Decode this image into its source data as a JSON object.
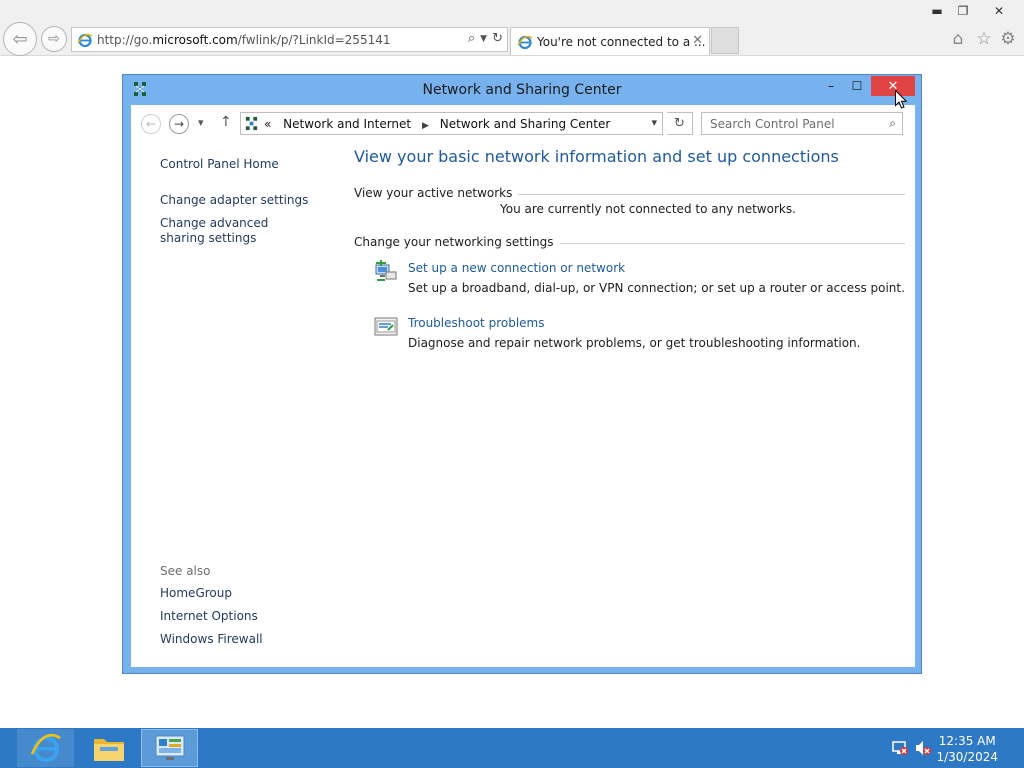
{
  "browser": {
    "url_prefix": "http://go.",
    "url_domain": "microsoft.com",
    "url_path": "/fwlink/p/?LinkId=255141",
    "tab_title": "You're not connected to a ...",
    "tab_close": "✕",
    "window_controls": {
      "minimize": "▬",
      "restore": "❐",
      "close": "✕"
    },
    "back_glyph": "⇦",
    "forward_glyph": "⇨",
    "icons": {
      "home": "⌂",
      "favorites": "☆",
      "tools": "⚙"
    }
  },
  "window": {
    "title": "Network and Sharing Center",
    "controls": {
      "minimize": "–",
      "maximize": "☐",
      "close": "✕"
    }
  },
  "toolbar": {
    "crumb_prefix": "«",
    "crumbs": [
      "Network and Internet",
      "Network and Sharing Center"
    ],
    "crumb_separator": "▶",
    "search_placeholder": "Search Control Panel",
    "glyphs": {
      "back": "←",
      "forward": "→",
      "recent": "▾",
      "up": "↑",
      "dropdown": "▾",
      "refresh": "↻",
      "search": "⌕"
    }
  },
  "sidebar": {
    "home": "Control Panel Home",
    "links": [
      "Change adapter settings",
      "Change advanced sharing settings"
    ],
    "see_also_label": "See also",
    "see_also": [
      "HomeGroup",
      "Internet Options",
      "Windows Firewall"
    ]
  },
  "main": {
    "heading": "View your basic network information and set up connections",
    "active_networks_label": "View your active networks",
    "no_networks": "You are currently not connected to any networks.",
    "change_settings_label": "Change your networking settings",
    "tasks": [
      {
        "title": "Set up a new connection or network",
        "description": "Set up a broadband, dial-up, or VPN connection; or set up a router or access point.",
        "icon": "network-setup-icon"
      },
      {
        "title": "Troubleshoot problems",
        "description": "Diagnose and repair network problems, or get troubleshooting information.",
        "icon": "troubleshoot-icon"
      }
    ]
  },
  "taskbar": {
    "apps": [
      "internet-explorer-icon",
      "file-explorer-icon",
      "control-panel-icon"
    ],
    "time": "12:35 AM",
    "date": "1/30/2024"
  },
  "colors": {
    "accent": "#78b2ee",
    "link": "#1e5aa0",
    "close": "#e04343",
    "taskbar": "#2e79c6"
  }
}
